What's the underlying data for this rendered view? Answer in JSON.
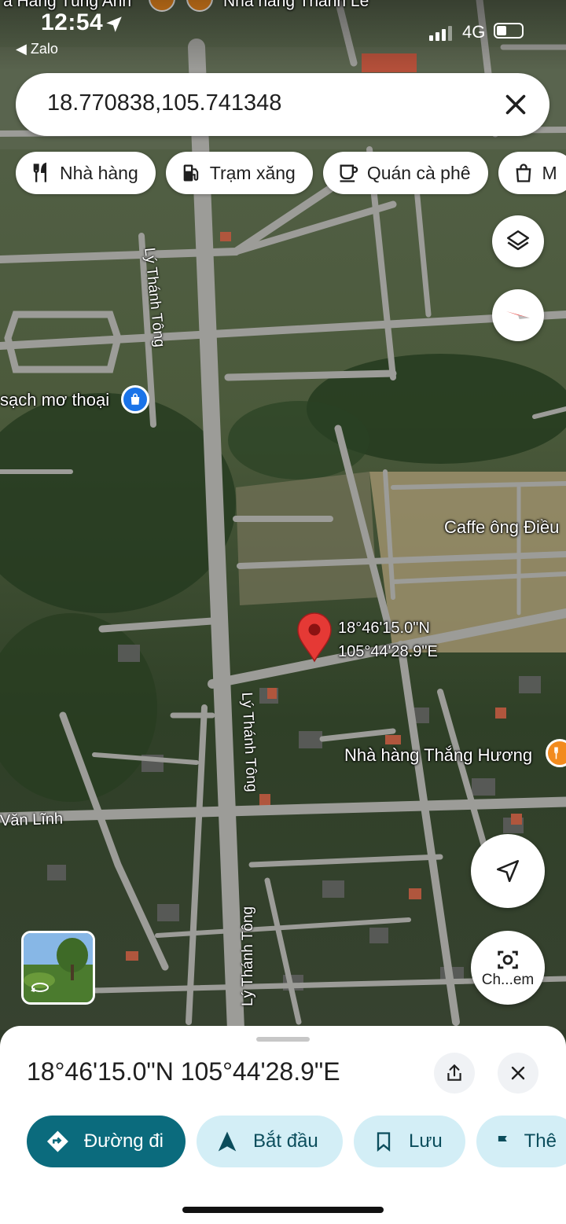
{
  "status_bar": {
    "time": "12:54",
    "back_app": "Zalo",
    "network": "4G"
  },
  "search": {
    "query": "18.770838,105.741348",
    "clear_icon": "close-icon"
  },
  "chips": [
    {
      "label": "Nhà hàng",
      "icon": "fork-knife-icon"
    },
    {
      "label": "Trạm xăng",
      "icon": "gas-pump-icon"
    },
    {
      "label": "Quán cà phê",
      "icon": "coffee-icon"
    },
    {
      "label": "M",
      "icon": "shopping-bag-icon"
    }
  ],
  "map": {
    "top_labels": {
      "left": "a Hàng Tùng Anh",
      "right": "Nhà hàng Thanh Lê"
    },
    "place_labels": {
      "shop": "sạch mơ thoại",
      "cafe": "Caffe ông Điều",
      "restaurant": "Nhà hàng Thắng Hương",
      "pin_lat": "18°46'15.0\"N",
      "pin_lng": "105°44'28.9\"E"
    },
    "road_labels": {
      "street_1": "Lý Thánh Tông",
      "street_2": "Lý Thánh Tông",
      "street_3": "Lý Thánh Tông",
      "street_4": "Văn Lĩnh"
    },
    "buttons": {
      "layers": "layers-icon",
      "compass": "compass-icon",
      "my_location": "navigation-arrow-icon",
      "lens_label": "Ch...em"
    }
  },
  "sheet": {
    "title": "18°46'15.0\"N 105°44'28.9\"E",
    "share_icon": "share-icon",
    "close_icon": "close-icon",
    "actions": [
      {
        "label": "Đường đi",
        "icon": "directions-icon",
        "style": "primary"
      },
      {
        "label": "Bắt đầu",
        "icon": "navigation-arrow-icon",
        "style": "tonal"
      },
      {
        "label": "Lưu",
        "icon": "bookmark-icon",
        "style": "tonal"
      },
      {
        "label": "Thê",
        "icon": "flag-icon",
        "style": "tonal"
      }
    ]
  },
  "colors": {
    "primary": "#0b6b7d",
    "tonal": "#d3eef6",
    "pin": "#e53935",
    "road": "#9a9a94",
    "accent_poi": "#f28b1e",
    "shop_poi": "#1a73e8"
  }
}
